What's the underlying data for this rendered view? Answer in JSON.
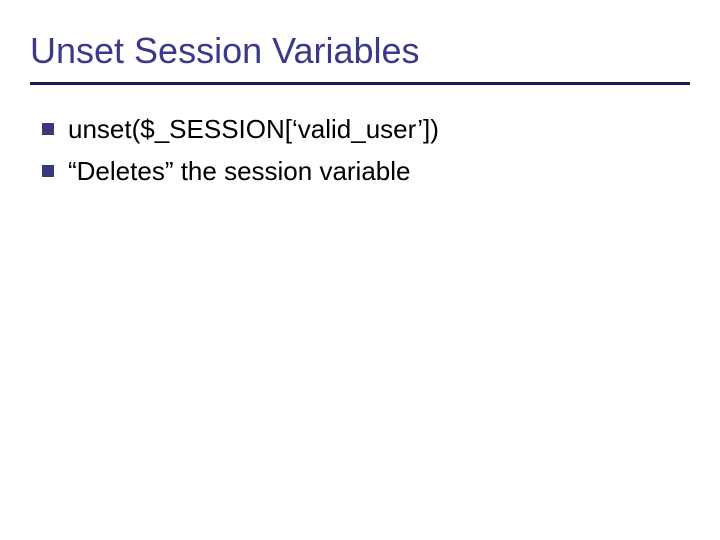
{
  "slide": {
    "title": "Unset Session Variables",
    "bullets": [
      "unset($_SESSION[‘valid_user’])",
      "“Deletes” the session variable"
    ]
  }
}
